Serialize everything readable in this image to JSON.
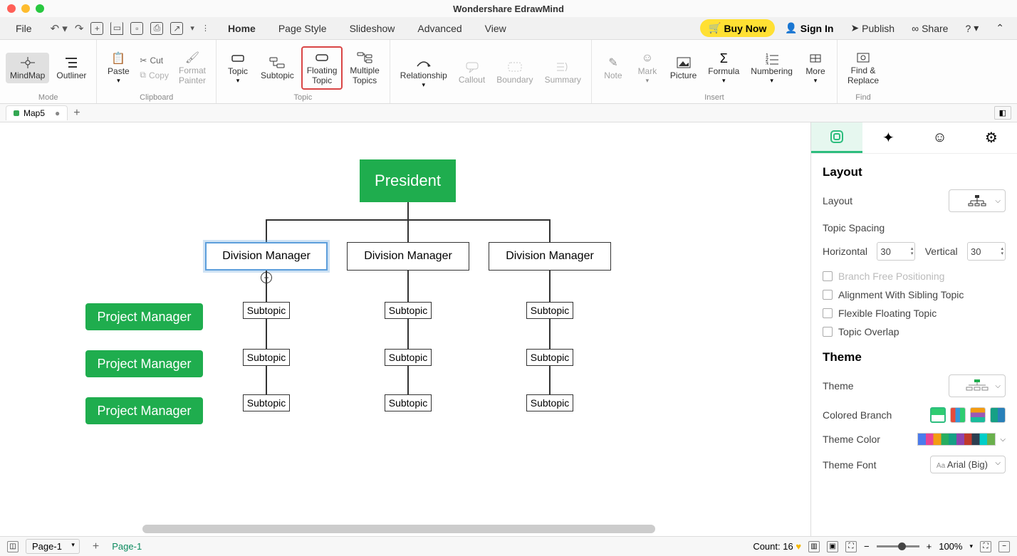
{
  "app_title": "Wondershare EdrawMind",
  "menu": {
    "file": "File",
    "tabs": [
      "Home",
      "Page Style",
      "Slideshow",
      "Advanced",
      "View"
    ],
    "active_tab": "Home",
    "buy_now": "Buy Now",
    "sign_in": "Sign In",
    "publish": "Publish",
    "share": "Share"
  },
  "ribbon": {
    "mode": {
      "mindmap": "MindMap",
      "outliner": "Outliner",
      "label": "Mode"
    },
    "clipboard": {
      "paste": "Paste",
      "cut": "Cut",
      "copy": "Copy",
      "format_painter": "Format\nPainter",
      "label": "Clipboard"
    },
    "topic": {
      "topic": "Topic",
      "subtopic": "Subtopic",
      "floating": "Floating\nTopic",
      "multiple": "Multiple\nTopics",
      "label": "Topic"
    },
    "relationship": "Relationship",
    "callout": "Callout",
    "boundary": "Boundary",
    "summary": "Summary",
    "insert": {
      "note": "Note",
      "mark": "Mark",
      "picture": "Picture",
      "formula": "Formula",
      "numbering": "Numbering",
      "more": "More",
      "label": "Insert"
    },
    "find": {
      "find_replace": "Find &\nReplace",
      "label": "Find"
    }
  },
  "doc_tab": "Map5",
  "chart": {
    "president": "President",
    "division": "Division Manager",
    "subtopic": "Subtopic",
    "project_manager": "Project Manager"
  },
  "layout_panel": {
    "layout_heading": "Layout",
    "layout_label": "Layout",
    "topic_spacing": "Topic Spacing",
    "horizontal": "Horizontal",
    "horizontal_val": "30",
    "vertical": "Vertical",
    "vertical_val": "30",
    "branch_free": "Branch Free Positioning",
    "alignment_sibling": "Alignment With Sibling Topic",
    "flexible_floating": "Flexible Floating Topic",
    "topic_overlap": "Topic Overlap",
    "theme_heading": "Theme",
    "theme_label": "Theme",
    "colored_branch": "Colored Branch",
    "theme_color": "Theme Color",
    "theme_font": "Theme Font",
    "theme_font_val": "Arial (Big)"
  },
  "status": {
    "page_selector": "Page-1",
    "page_active": "Page-1",
    "count_label": "Count: 16",
    "zoom": "100%"
  }
}
